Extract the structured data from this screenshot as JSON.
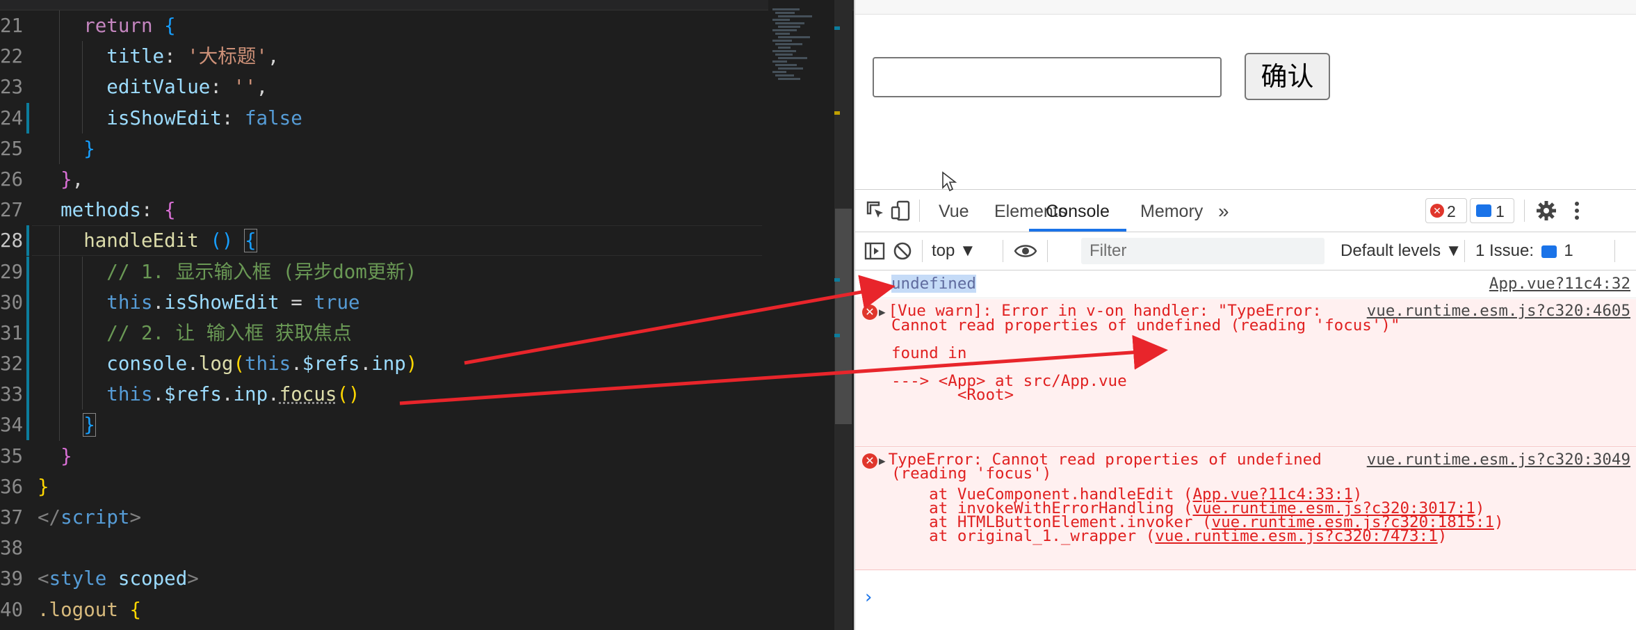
{
  "editor": {
    "lines": [
      {
        "n": "21",
        "tokens": [
          [
            "kw",
            "return"
          ],
          [
            "plain",
            " "
          ],
          [
            "br3",
            "{"
          ]
        ],
        "indent": 4
      },
      {
        "n": "22",
        "tokens": [
          [
            "prop",
            "title"
          ],
          [
            "plain",
            ": "
          ],
          [
            "str",
            "'大标题'"
          ],
          [
            "plain",
            ","
          ]
        ],
        "indent": 6
      },
      {
        "n": "23",
        "tokens": [
          [
            "prop",
            "editValue"
          ],
          [
            "plain",
            ": "
          ],
          [
            "str",
            "''"
          ],
          [
            "plain",
            ","
          ]
        ],
        "indent": 6
      },
      {
        "n": "24",
        "tokens": [
          [
            "prop",
            "isShowEdit"
          ],
          [
            "plain",
            ": "
          ],
          [
            "bool",
            "false"
          ]
        ],
        "indent": 6
      },
      {
        "n": "25",
        "tokens": [
          [
            "br3",
            "}"
          ]
        ],
        "indent": 4
      },
      {
        "n": "26",
        "tokens": [
          [
            "br2",
            "}"
          ],
          [
            "plain",
            ","
          ]
        ],
        "indent": 2
      },
      {
        "n": "27",
        "tokens": [
          [
            "prop",
            "methods"
          ],
          [
            "plain",
            ": "
          ],
          [
            "br2",
            "{"
          ]
        ],
        "indent": 2
      },
      {
        "n": "28",
        "tokens": [
          [
            "fn",
            "handleEdit"
          ],
          [
            "plain",
            " "
          ],
          [
            "br3",
            "()"
          ],
          [
            "plain",
            " "
          ],
          [
            "br3",
            "{"
          ]
        ],
        "indent": 4
      },
      {
        "n": "29",
        "tokens": [
          [
            "com",
            "// 1. 显示输入框 (异步dom更新)"
          ]
        ],
        "indent": 6
      },
      {
        "n": "30",
        "tokens": [
          [
            "this",
            "this"
          ],
          [
            "plain",
            "."
          ],
          [
            "prop",
            "isShowEdit"
          ],
          [
            "plain",
            " = "
          ],
          [
            "bool",
            "true"
          ]
        ],
        "indent": 6
      },
      {
        "n": "31",
        "tokens": [
          [
            "com",
            "// 2. 让 输入框 获取焦点"
          ]
        ],
        "indent": 6
      },
      {
        "n": "32",
        "tokens": [
          [
            "prop",
            "console"
          ],
          [
            "plain",
            "."
          ],
          [
            "fn",
            "log"
          ],
          [
            "br1",
            "("
          ],
          [
            "this",
            "this"
          ],
          [
            "plain",
            "."
          ],
          [
            "prop",
            "$refs"
          ],
          [
            "plain",
            "."
          ],
          [
            "prop",
            "inp"
          ],
          [
            "br1",
            ")"
          ]
        ],
        "indent": 6
      },
      {
        "n": "33",
        "tokens": [
          [
            "this",
            "this"
          ],
          [
            "plain",
            "."
          ],
          [
            "prop",
            "$refs"
          ],
          [
            "plain",
            "."
          ],
          [
            "prop",
            "inp"
          ],
          [
            "plain",
            "."
          ],
          [
            "fn",
            "focus"
          ],
          [
            "br1",
            "()"
          ]
        ],
        "indent": 6
      },
      {
        "n": "34",
        "tokens": [
          [
            "br3",
            "}"
          ]
        ],
        "indent": 4
      },
      {
        "n": "35",
        "tokens": [
          [
            "br2",
            "}"
          ]
        ],
        "indent": 2
      },
      {
        "n": "36",
        "tokens": [
          [
            "br1",
            "}"
          ]
        ],
        "indent": 0
      },
      {
        "n": "37",
        "tokens": [
          [
            "tag",
            "</"
          ],
          [
            "tagname",
            "script"
          ],
          [
            "tag",
            ">"
          ]
        ],
        "indent": 0
      },
      {
        "n": "38",
        "tokens": [],
        "indent": 0
      },
      {
        "n": "39",
        "tokens": [
          [
            "tag",
            "<"
          ],
          [
            "tagname",
            "style"
          ],
          [
            "plain",
            " "
          ],
          [
            "attr",
            "scoped"
          ],
          [
            "tag",
            ">"
          ]
        ],
        "indent": 0
      },
      {
        "n": "40",
        "tokens": [
          [
            "sel",
            ".logout"
          ],
          [
            "plain",
            " "
          ],
          [
            "br1",
            "{"
          ]
        ],
        "indent": 0
      }
    ]
  },
  "page": {
    "confirm_button": "确认",
    "input_value": ""
  },
  "devtools": {
    "tabs": [
      "Vue",
      "Elements",
      "Console",
      "Memory"
    ],
    "active_tab": "Console",
    "more_tabs": "»",
    "error_count": "2",
    "message_count": "1",
    "context": "top",
    "filter_placeholder": "Filter",
    "levels": "Default levels",
    "issues_label": "1 Issue:",
    "issues_count": "1"
  },
  "console": {
    "log": {
      "text": "undefined",
      "source": "App.vue?11c4:32"
    },
    "error1": {
      "l1": "[Vue warn]: Error in v-on handler: \"TypeError:",
      "source": "vue.runtime.esm.js?c320:4605",
      "l2": "Cannot read properties of undefined (reading 'focus')\"",
      "l3": "found in",
      "l4": "---> <App> at src/App.vue",
      "l5": "       <Root>"
    },
    "error2": {
      "l1": "TypeError: Cannot read properties of undefined",
      "source": "vue.runtime.esm.js?c320:3049",
      "l2": "(reading 'focus')",
      "stack": [
        {
          "prefix": "    at VueComponent.handleEdit (",
          "link": "App.vue?11c4:33:1",
          "suffix": ")"
        },
        {
          "prefix": "    at invokeWithErrorHandling (",
          "link": "vue.runtime.esm.js?c320:3017:1",
          "suffix": ")"
        },
        {
          "prefix": "    at HTMLButtonElement.invoker (",
          "link": "vue.runtime.esm.js?c320:1815:1",
          "suffix": ")"
        },
        {
          "prefix": "    at original_1._wrapper (",
          "link": "vue.runtime.esm.js?c320:7473:1",
          "suffix": ")"
        }
      ]
    },
    "prompt": "›"
  },
  "colors": {
    "arrow": "#e8252b",
    "accent": "#1a73e8",
    "error": "#e02020"
  }
}
